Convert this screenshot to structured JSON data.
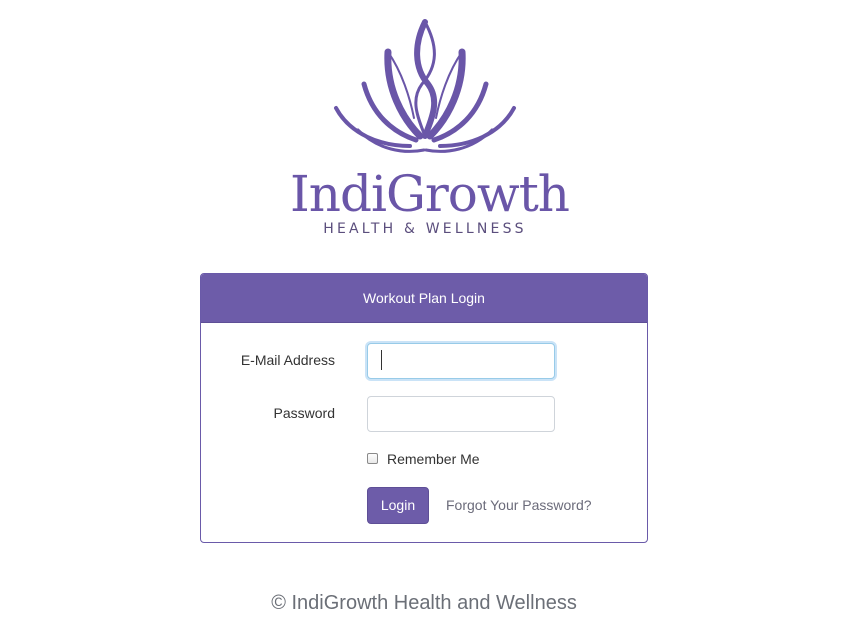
{
  "brand": {
    "name": "IndiGrowth",
    "tagline": "HEALTH & WELLNESS",
    "color": "#6a56a8"
  },
  "card": {
    "title": "Workout Plan Login",
    "header_color": "#6d5ca9"
  },
  "form": {
    "email_label": "E-Mail Address",
    "email_value": "",
    "password_label": "Password",
    "password_value": "",
    "remember_label": "Remember Me",
    "remember_checked": false,
    "login_label": "Login",
    "forgot_label": "Forgot Your Password?"
  },
  "footer": {
    "text": "© IndiGrowth Health and Wellness"
  },
  "icons": {
    "logo": "lotus-icon"
  }
}
